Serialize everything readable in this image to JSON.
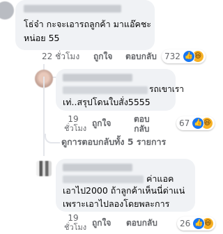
{
  "comments": [
    {
      "text_line1": "โธ่จ๋า กะจะเอารถลูกค้า มาแอ๊คชะ",
      "text_line2": "หน่อย 55",
      "time": "22 ชั่วโมง",
      "like_label": "ถูกใจ",
      "reply_label": "ตอบกลับ",
      "reaction_count": "732",
      "reaction_icons": [
        "like-icon",
        "haha-icon"
      ]
    },
    {
      "text_line1": "รถเขาเรา",
      "text_line2": "เท่..สรุปโดนใบสั่ง5555",
      "time_line1": "19",
      "time_line2": "ชั่วโมง",
      "like_label": "ถูกใจ",
      "reply_line1": "ตอบ",
      "reply_line2": "กลับ",
      "reaction_count": "67",
      "reaction_icons": [
        "like-icon",
        "haha-icon"
      ],
      "view_replies": "ดูการตอบกลับทั้ง 5 รายการ"
    },
    {
      "text_line1": "ค่าแอค",
      "text_line2": "เอาไป2000 ถ้าลูกค้าเห็นนี่ด่าแน่",
      "text_line3": "เพราะเอาไปลองโดยพละการ",
      "time_line1": "19",
      "time_line2": "ชั่วโมง",
      "like_label": "ถูกใจ",
      "reply_label": "ตอบกลับ",
      "reaction_count": "26",
      "reaction_icons": [
        "like-icon",
        "haha-icon"
      ]
    }
  ],
  "colors": {
    "bubble": "#f0f2f5",
    "meta_text": "#65676b",
    "like_blue": "#1877f2",
    "haha_yellow": "#f7b125"
  }
}
